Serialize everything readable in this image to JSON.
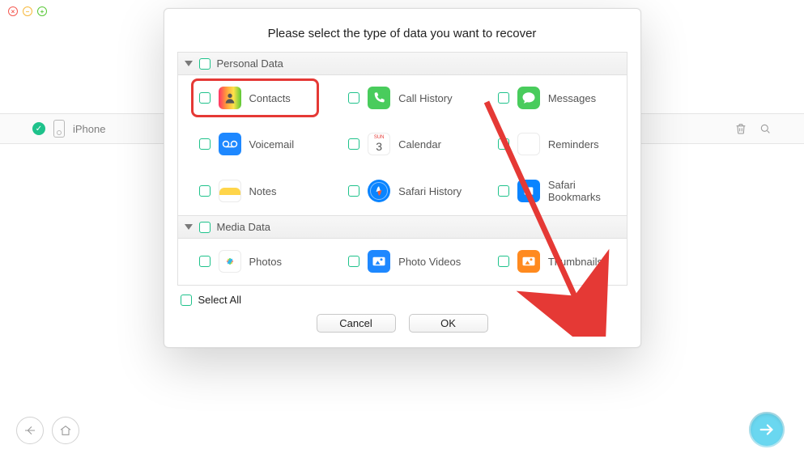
{
  "window": {
    "close": "×",
    "minimize": "–",
    "zoom": "+"
  },
  "device": {
    "name": "iPhone"
  },
  "modal": {
    "title": "Please select the type of data you want to recover",
    "groups": [
      {
        "label": "Personal Data",
        "items": [
          {
            "label": "Contacts",
            "icon": "contacts-icon"
          },
          {
            "label": "Call History",
            "icon": "phone-icon"
          },
          {
            "label": "Messages",
            "icon": "messages-icon"
          },
          {
            "label": "Voicemail",
            "icon": "voicemail-icon"
          },
          {
            "label": "Calendar",
            "icon": "calendar-icon",
            "day": "3",
            "dow": "SUN"
          },
          {
            "label": "Reminders",
            "icon": "reminders-icon"
          },
          {
            "label": "Notes",
            "icon": "notes-icon"
          },
          {
            "label": "Safari History",
            "icon": "safari-history-icon"
          },
          {
            "label": "Safari Bookmarks",
            "icon": "safari-bookmarks-icon"
          }
        ]
      },
      {
        "label": "Media Data",
        "items": [
          {
            "label": "Photos",
            "icon": "photos-icon"
          },
          {
            "label": "Photo Videos",
            "icon": "photo-videos-icon"
          },
          {
            "label": "Thumbnails",
            "icon": "thumbnails-icon"
          }
        ]
      }
    ],
    "select_all": "Select All",
    "buttons": {
      "cancel": "Cancel",
      "ok": "OK"
    }
  }
}
